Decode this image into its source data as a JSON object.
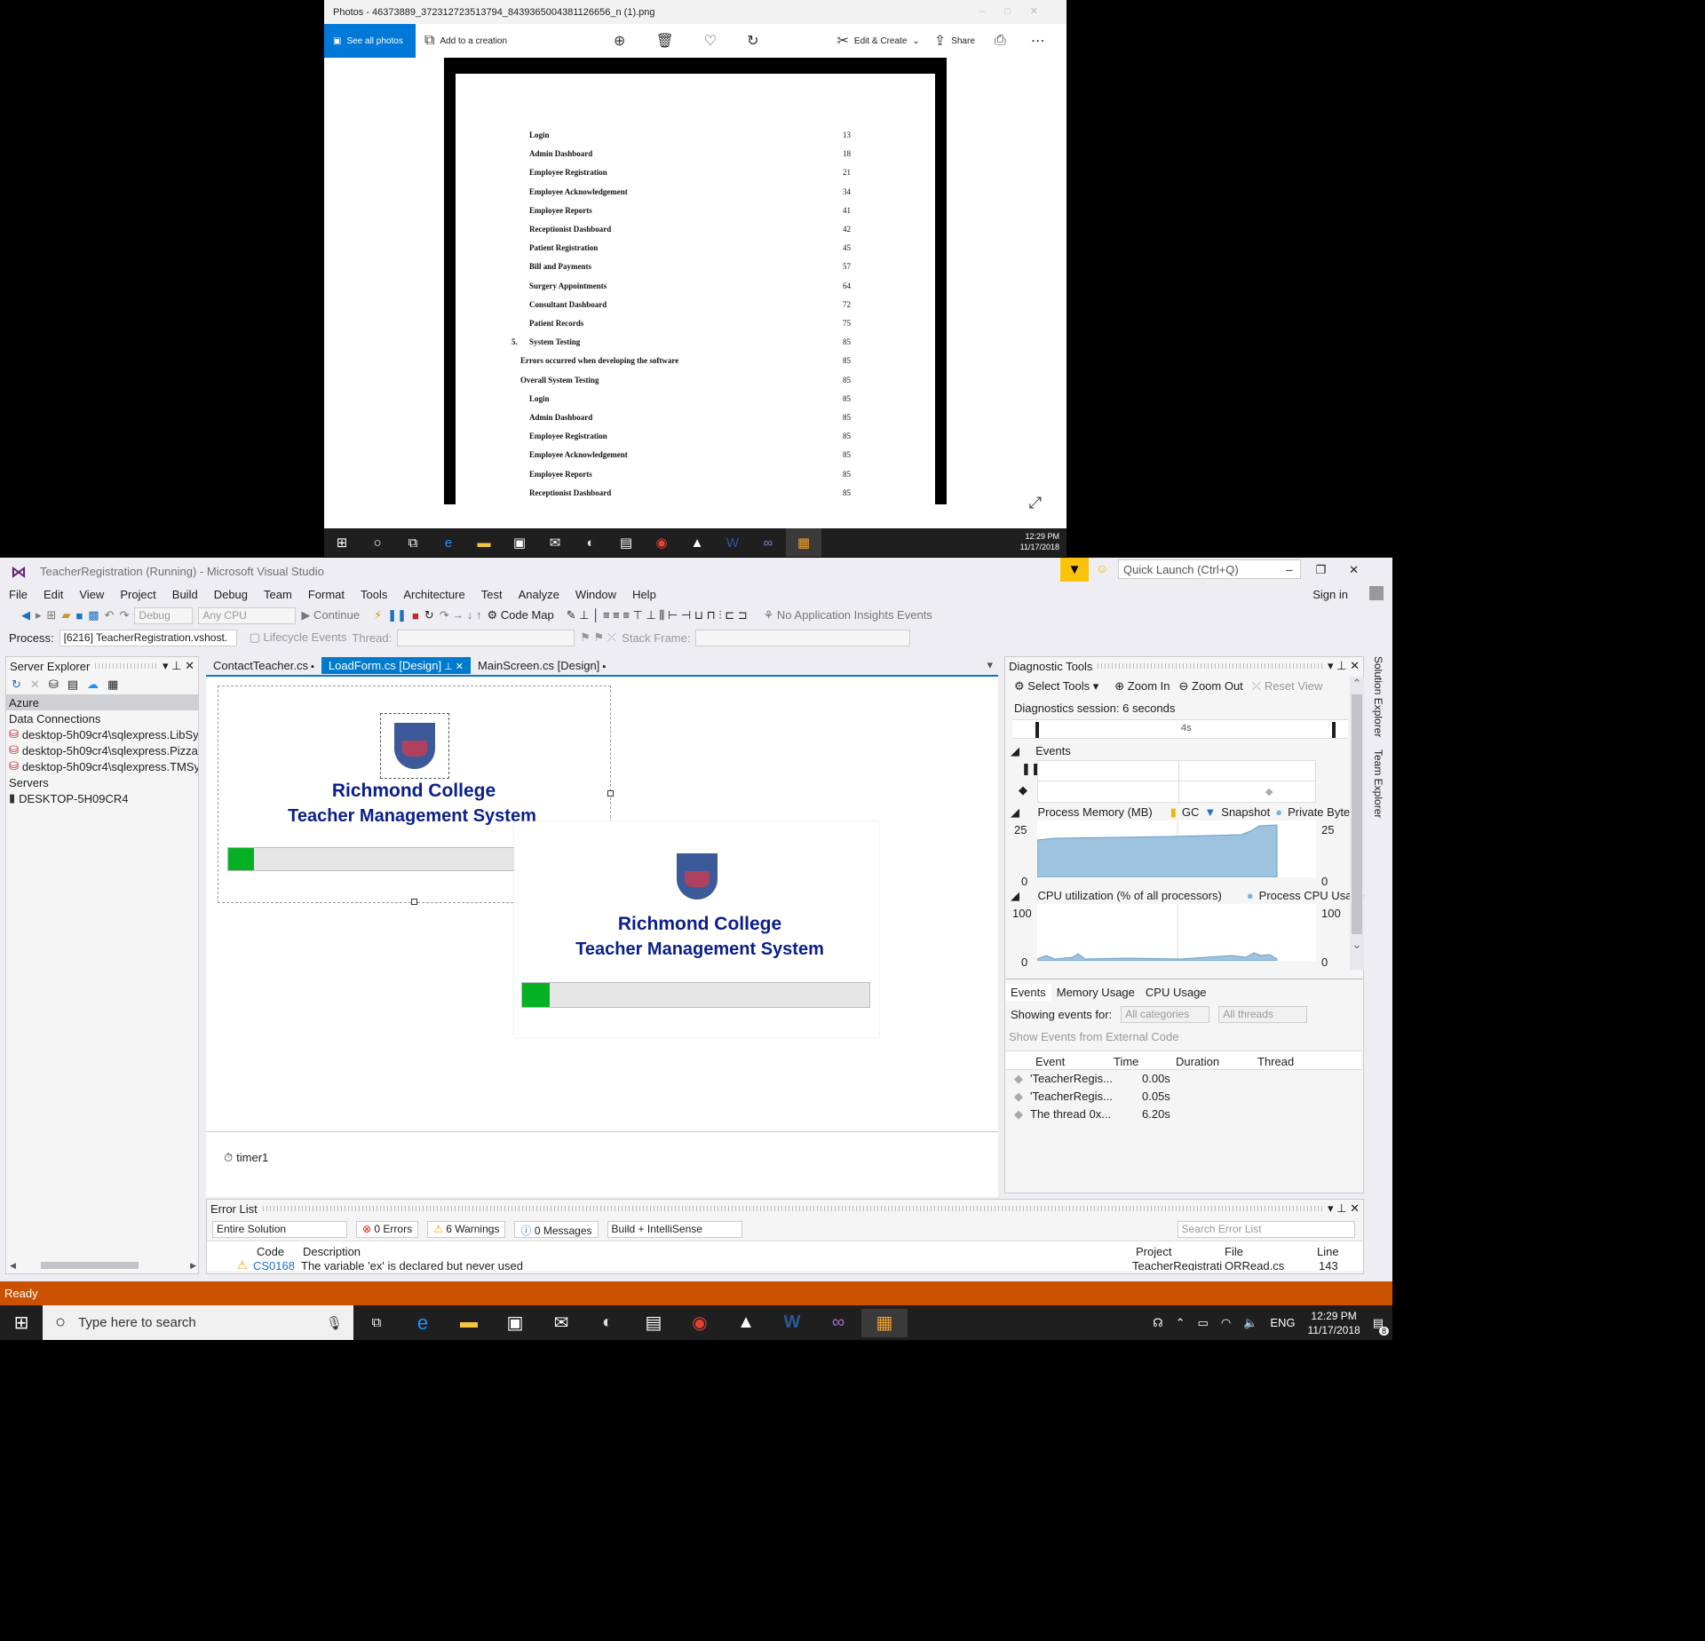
{
  "photos": {
    "title": "Photos - 46373889_372312723513794_8439365004381126656_n (1).png",
    "see_all": "See all photos",
    "add_creation": "Add to a creation",
    "edit_create": "Edit & Create",
    "share": "Share",
    "toc": [
      {
        "num": "",
        "label": "Login",
        "page": "13",
        "indent": 2
      },
      {
        "num": "",
        "label": "Admin Dashboard",
        "page": "18",
        "indent": 2
      },
      {
        "num": "",
        "label": "Employee Registration",
        "page": "21",
        "indent": 2
      },
      {
        "num": "",
        "label": "Employee Acknowledgement",
        "page": "34",
        "indent": 2
      },
      {
        "num": "",
        "label": "Employee Reports",
        "page": "41",
        "indent": 2
      },
      {
        "num": "",
        "label": "Receptionist Dashboard",
        "page": "42",
        "indent": 2
      },
      {
        "num": "",
        "label": "Patient Registration",
        "page": "45",
        "indent": 2
      },
      {
        "num": "",
        "label": "Bill and Payments",
        "page": "57",
        "indent": 2
      },
      {
        "num": "",
        "label": "Surgery Appointments",
        "page": "64",
        "indent": 2
      },
      {
        "num": "",
        "label": "Consultant Dashboard",
        "page": "72",
        "indent": 2
      },
      {
        "num": "",
        "label": "Patient Records",
        "page": "75",
        "indent": 2
      },
      {
        "num": "5.",
        "label": "System Testing",
        "page": "85",
        "indent": 2
      },
      {
        "num": "",
        "label": "Errors occurred when developing the software",
        "page": "85",
        "indent": 1
      },
      {
        "num": "",
        "label": "Overall System Testing",
        "page": "85",
        "indent": 1
      },
      {
        "num": "",
        "label": "Login",
        "page": "85",
        "indent": 2
      },
      {
        "num": "",
        "label": "Admin Dashboard",
        "page": "85",
        "indent": 2
      },
      {
        "num": "",
        "label": "Employee Registration",
        "page": "85",
        "indent": 2
      },
      {
        "num": "",
        "label": "Employee Acknowledgement",
        "page": "85",
        "indent": 2
      },
      {
        "num": "",
        "label": "Employee Reports",
        "page": "85",
        "indent": 2
      },
      {
        "num": "",
        "label": "Receptionist Dashboard",
        "page": "85",
        "indent": 2
      }
    ]
  },
  "taskbar_top": {
    "time": "12:29 PM",
    "date": "11/17/2018"
  },
  "vs": {
    "title": "TeacherRegistration (Running) - Microsoft Visual Studio",
    "quick_launch": "Quick Launch (Ctrl+Q)",
    "sign_in": "Sign in",
    "menu": [
      "File",
      "Edit",
      "View",
      "Project",
      "Build",
      "Debug",
      "Team",
      "Format",
      "Tools",
      "Architecture",
      "Test",
      "Analyze",
      "Window",
      "Help"
    ],
    "toolbar": {
      "config": "Debug",
      "platform": "Any CPU",
      "continue": "Continue",
      "code_map": "Code Map",
      "insights": "No Application Insights Events"
    },
    "toolbar2": {
      "process_label": "Process:",
      "process": "[6216] TeacherRegistration.vshost.",
      "lifecycle": "Lifecycle Events",
      "thread_label": "Thread:",
      "stack_label": "Stack Frame:"
    },
    "server_explorer": {
      "title": "Server Explorer",
      "items": [
        {
          "label": "Azure",
          "level": 0,
          "selected": true
        },
        {
          "label": "Data Connections",
          "level": 0
        },
        {
          "label": "desktop-5h09cr4\\sqlexpress.LibSyste",
          "level": 1,
          "icon": "db-error"
        },
        {
          "label": "desktop-5h09cr4\\sqlexpress.PizzaOr",
          "level": 1,
          "icon": "db-error"
        },
        {
          "label": "desktop-5h09cr4\\sqlexpress.TMSyste",
          "level": 1,
          "icon": "db-error"
        },
        {
          "label": "Servers",
          "level": 0
        },
        {
          "label": "DESKTOP-5H09CR4",
          "level": 1,
          "icon": "server"
        }
      ]
    },
    "tabs": [
      {
        "label": "ContactTeacher.cs",
        "active": false
      },
      {
        "label": "LoadForm.cs [Design]",
        "active": true
      },
      {
        "label": "MainScreen.cs [Design]",
        "active": false
      }
    ],
    "form": {
      "line1": "Richmond College",
      "line2": "Teacher Management System",
      "progress": 0.09
    },
    "splash": {
      "line1": "Richmond College",
      "line2": "Teacher Management System",
      "progress": 0.08
    },
    "tray": {
      "timer": "timer1"
    },
    "diagnostics": {
      "title": "Diagnostic Tools",
      "select_tools": "Select Tools",
      "zoom_in": "Zoom In",
      "zoom_out": "Zoom Out",
      "reset_view": "Reset View",
      "session": "Diagnostics session: 6 seconds",
      "ruler": "4s",
      "events_label": "Events",
      "memory_label": "Process Memory (MB)",
      "gc": "GC",
      "snapshot": "Snapshot",
      "private_bytes": "Private Bytes",
      "mem_max": "25",
      "mem_min": "0",
      "cpu_label": "CPU utilization (% of all processors)",
      "cpu_legend": "Process CPU Usage",
      "cpu_max": "100",
      "cpu_min": "0",
      "subtabs": [
        "Events",
        "Memory Usage",
        "CPU Usage"
      ],
      "showing": "Showing events for:",
      "all_categories": "All categories",
      "all_threads": "All threads",
      "external": "Show Events from External Code",
      "cols": [
        "Event",
        "Time",
        "Duration",
        "Thread"
      ],
      "rows": [
        {
          "event": "'TeacherRegis...",
          "time": "0.00s"
        },
        {
          "event": "'TeacherRegis...",
          "time": "0.05s"
        },
        {
          "event": "The thread 0x...",
          "time": "6.20s"
        }
      ]
    },
    "error_list": {
      "title": "Error List",
      "scope": "Entire Solution",
      "errors": "0 Errors",
      "warnings": "6 Warnings",
      "messages": "0 Messages",
      "build": "Build + IntelliSense",
      "search": "Search Error List",
      "cols": [
        "Code",
        "Description",
        "Project",
        "File",
        "Line"
      ],
      "row": {
        "code": "CS0168",
        "desc": "The variable 'ex' is declared but never used",
        "project": "TeacherRegistrati",
        "file": "ORRead.cs",
        "line": "143"
      }
    },
    "side_tabs": [
      "Solution Explorer",
      "Team Explorer"
    ],
    "status": "Ready"
  },
  "taskbar": {
    "search": "Type here to search",
    "lang": "ENG",
    "time": "12:29 PM",
    "date": "11/17/2018",
    "notif": "8"
  }
}
